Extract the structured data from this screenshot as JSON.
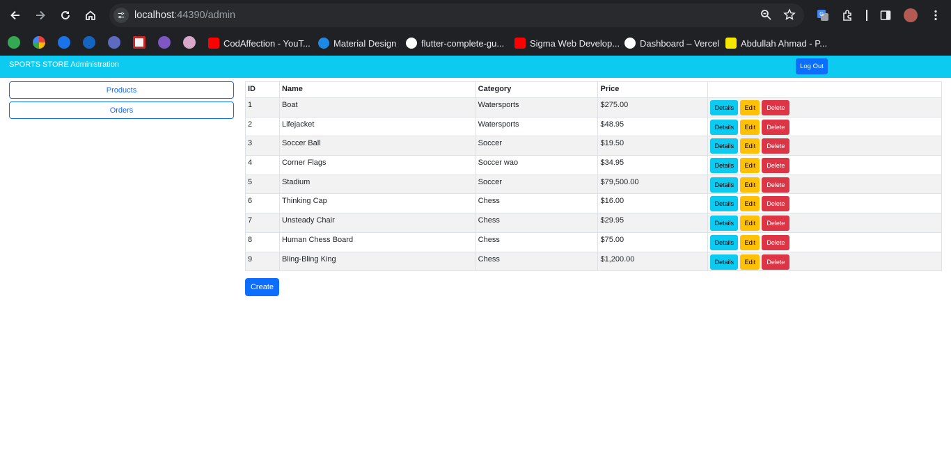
{
  "browser": {
    "url_host": "localhost",
    "url_path": ":44390/admin",
    "bookmarks": [
      {
        "label": "CodAffection - YouT...",
        "icon": "youtube-icon",
        "color": "#ff0000"
      },
      {
        "label": "Material Design",
        "icon": "material-design-icon",
        "color": "#1e88e5"
      },
      {
        "label": "flutter-complete-gu...",
        "icon": "github-icon",
        "color": "#ffffff"
      },
      {
        "label": "Sigma Web Develop...",
        "icon": "youtube-icon",
        "color": "#ff0000"
      },
      {
        "label": "Dashboard – Vercel",
        "icon": "vercel-icon",
        "color": "#ffffff"
      },
      {
        "label": "Abdullah Ahmad - P...",
        "icon": "ab-icon",
        "color": "#f5e600"
      }
    ]
  },
  "header": {
    "brand": "SPORTS STORE Administration",
    "logout_label": "Log Out"
  },
  "sidebar": {
    "items": [
      {
        "label": "Products"
      },
      {
        "label": "Orders"
      }
    ]
  },
  "table": {
    "headers": [
      "ID",
      "Name",
      "Category",
      "Price",
      ""
    ],
    "rows": [
      {
        "id": "1",
        "name": "Boat",
        "category": "Watersports",
        "price": "$275.00"
      },
      {
        "id": "2",
        "name": "Lifejacket",
        "category": "Watersports",
        "price": "$48.95"
      },
      {
        "id": "3",
        "name": "Soccer Ball",
        "category": "Soccer",
        "price": "$19.50"
      },
      {
        "id": "4",
        "name": "Corner Flags",
        "category": "Soccer wao",
        "price": "$34.95"
      },
      {
        "id": "5",
        "name": "Stadium",
        "category": "Soccer",
        "price": "$79,500.00"
      },
      {
        "id": "6",
        "name": "Thinking Cap",
        "category": "Chess",
        "price": "$16.00"
      },
      {
        "id": "7",
        "name": "Unsteady Chair",
        "category": "Chess",
        "price": "$29.95"
      },
      {
        "id": "8",
        "name": "Human Chess Board",
        "category": "Chess",
        "price": "$75.00"
      },
      {
        "id": "9",
        "name": "Bling-Bling King",
        "category": "Chess",
        "price": "$1,200.00"
      }
    ],
    "actions": {
      "details_label": "Details",
      "edit_label": "Edit",
      "delete_label": "Delete"
    }
  },
  "create_label": "Create",
  "colors": {
    "header_bg": "#0dcaf0",
    "primary": "#0d6efd",
    "info": "#0dcaf0",
    "warning": "#ffc107",
    "danger": "#dc3545"
  }
}
